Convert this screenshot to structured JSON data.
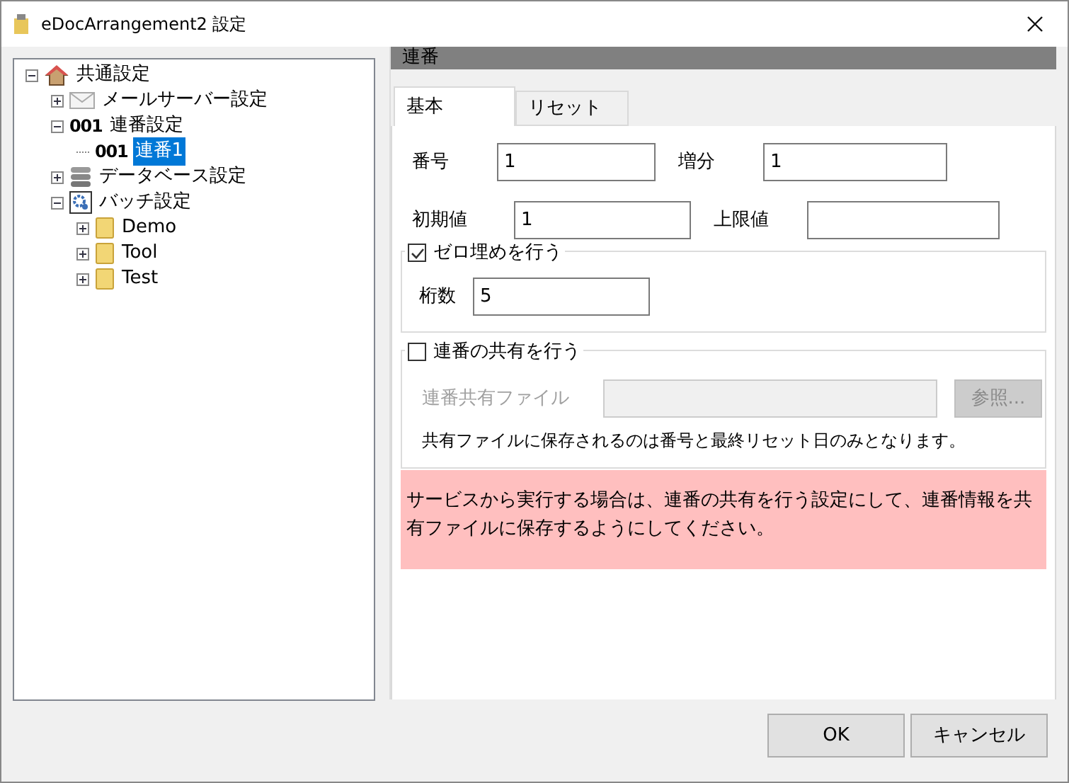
{
  "window": {
    "title": "eDocArrangement2 設定"
  },
  "tree": [
    {
      "label": "共通設定",
      "kind": "home",
      "expanded": true,
      "selected": false,
      "children": [
        {
          "label": "メールサーバー設定",
          "kind": "mail",
          "expanded": false,
          "selected": false
        },
        {
          "label": "連番設定",
          "kind": "number",
          "badge": "001",
          "expanded": true,
          "selected": false,
          "children": [
            {
              "label": "連番1",
              "kind": "number",
              "badge": "001",
              "selected": true
            }
          ]
        },
        {
          "label": "データベース設定",
          "kind": "database",
          "expanded": false,
          "selected": false
        },
        {
          "label": "バッチ設定",
          "kind": "gear",
          "expanded": true,
          "selected": false,
          "children": [
            {
              "label": "Demo",
              "kind": "folder",
              "expanded": false,
              "selected": false
            },
            {
              "label": "Tool",
              "kind": "folder",
              "expanded": false,
              "selected": false
            },
            {
              "label": "Test",
              "kind": "folder",
              "expanded": false,
              "selected": false
            }
          ]
        }
      ]
    }
  ],
  "panel_header": "連番",
  "tabs": [
    {
      "label": "基本",
      "selected": true
    },
    {
      "label": "リセット",
      "selected": false
    }
  ],
  "fields": {
    "number": {
      "label": "番号",
      "value": "1"
    },
    "increment": {
      "label": "増分",
      "value": "1"
    },
    "initial": {
      "label": "初期値",
      "value": "1"
    },
    "max": {
      "label": "上限値"
    }
  },
  "zero_pad": {
    "label": "ゼロ埋めを行う",
    "checked": true,
    "digits": {
      "label": "桁数",
      "value": "5"
    }
  },
  "share": {
    "label": "連番の共有を行う",
    "checked": false,
    "file_label": "連番共有ファイル",
    "browse": "参照...",
    "note": "共有ファイルに保存されるのは番号と最終リセット日のみとなります。"
  },
  "warning": "サービスから実行する場合は、連番の共有を行う設定にして、連番情報を共有ファイルに保存するようにしてください。",
  "buttons": [
    "OK",
    "キャンセル"
  ]
}
